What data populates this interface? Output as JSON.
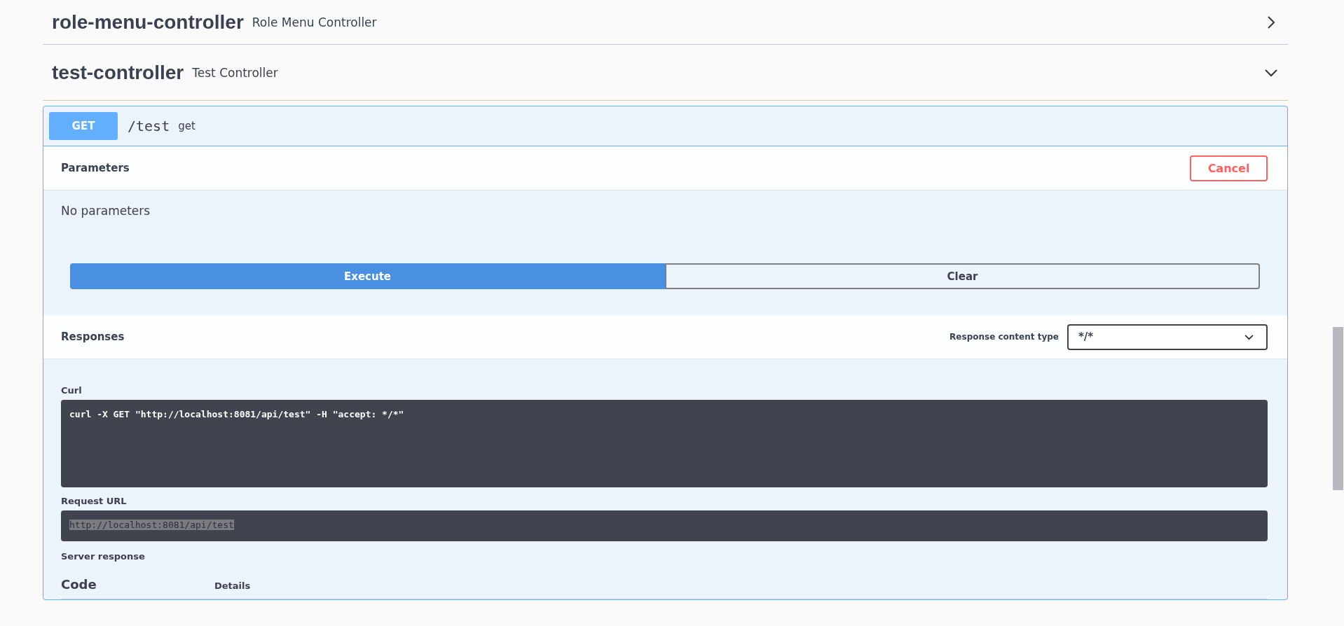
{
  "controllers": [
    {
      "name": "role-menu-controller",
      "description": "Role Menu Controller",
      "expanded": false
    },
    {
      "name": "test-controller",
      "description": "Test Controller",
      "expanded": true
    }
  ],
  "operation": {
    "method": "GET",
    "path": "/test",
    "summary": "get"
  },
  "parameters": {
    "title": "Parameters",
    "cancel_button": "Cancel",
    "empty_text": "No parameters"
  },
  "actions": {
    "execute_button": "Execute",
    "clear_button": "Clear"
  },
  "responses": {
    "title": "Responses",
    "content_type_label": "Response content type",
    "content_type_value": "*/*"
  },
  "curl": {
    "label": "Curl",
    "command": "curl -X GET \"http://localhost:8081/api/test\" -H \"accept: */*\""
  },
  "request_url": {
    "label": "Request URL",
    "value": "http://localhost:8081/api/test"
  },
  "server_response": {
    "label": "Server response",
    "columns": [
      "Code",
      "Details"
    ]
  }
}
